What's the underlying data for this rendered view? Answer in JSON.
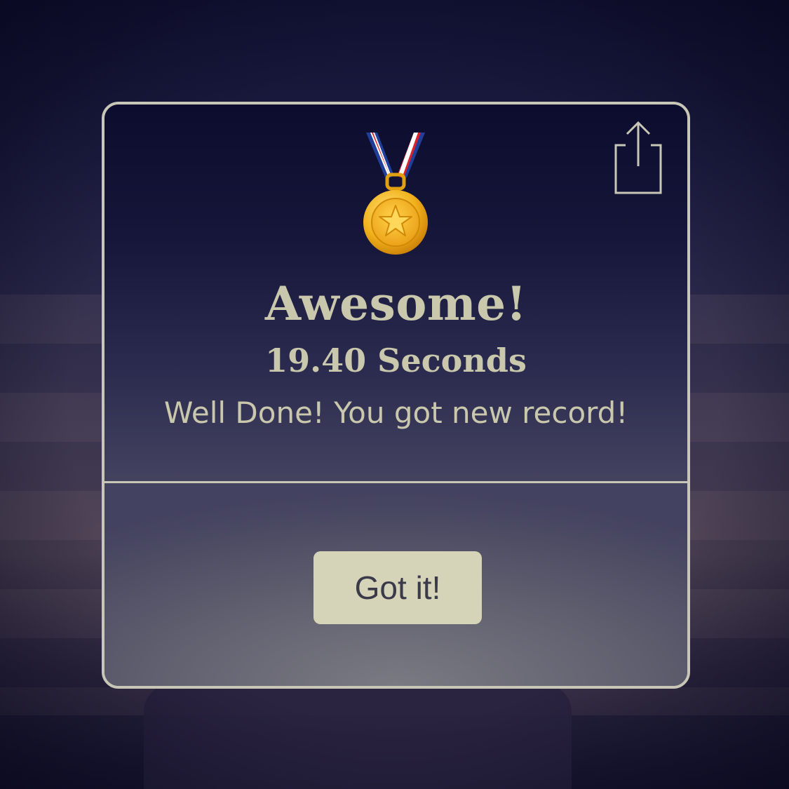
{
  "dialog": {
    "title": "Awesome!",
    "time_text": "19.40 Seconds",
    "message": "Well Done! You got new record!",
    "confirm_label": "Got it!",
    "share_icon": "share-icon",
    "medal_icon": "medal-icon"
  },
  "colors": {
    "text": "#c9c7ac",
    "border": "#c8c6b6",
    "button_bg": "#d6d4b8",
    "button_text": "#3a3a4a",
    "medal_gold": "#f2b21c",
    "ribbon_red": "#d8232a",
    "ribbon_blue": "#1f3f9a"
  }
}
